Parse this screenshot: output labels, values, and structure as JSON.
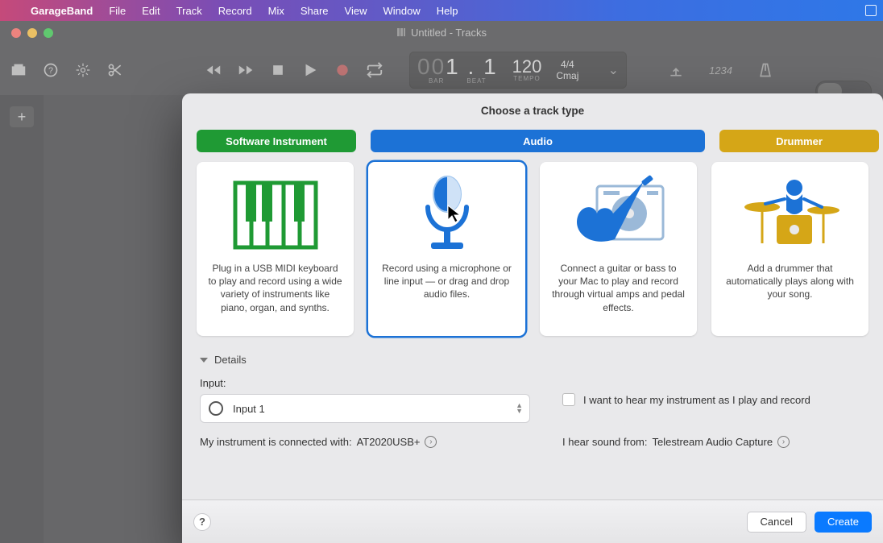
{
  "menubar": {
    "app": "GarageBand",
    "items": [
      "File",
      "Edit",
      "Track",
      "Record",
      "Mix",
      "Share",
      "View",
      "Window",
      "Help"
    ]
  },
  "window": {
    "title": "Untitled - Tracks"
  },
  "lcd": {
    "position": "1 . 1",
    "bar_label": "BAR",
    "beat_label": "BEAT",
    "tempo": "120",
    "tempo_label": "TEMPO",
    "timesig": "4/4",
    "key": "Cmaj"
  },
  "right_tools": {
    "count": "1234"
  },
  "sheet": {
    "title": "Choose a track type",
    "tabs": {
      "software": "Software Instrument",
      "audio": "Audio",
      "drummer": "Drummer"
    },
    "cards": {
      "software": "Plug in a USB MIDI keyboard to play and record using a wide variety of instruments like piano, organ, and synths.",
      "mic": "Record using a microphone or line input — or drag and drop audio files.",
      "guitar": "Connect a guitar or bass to your Mac to play and record through virtual amps and pedal effects.",
      "drummer": "Add a drummer that automatically plays along with your song."
    },
    "details_label": "Details",
    "input_label": "Input:",
    "input_value": "Input 1",
    "monitor_label": "I want to hear my instrument as I play and record",
    "connected_prefix": "My instrument is connected with: ",
    "connected_device": "AT2020USB+",
    "hear_prefix": "I hear sound from: ",
    "hear_device": "Telestream Audio Capture",
    "help": "?",
    "cancel": "Cancel",
    "create": "Create"
  }
}
